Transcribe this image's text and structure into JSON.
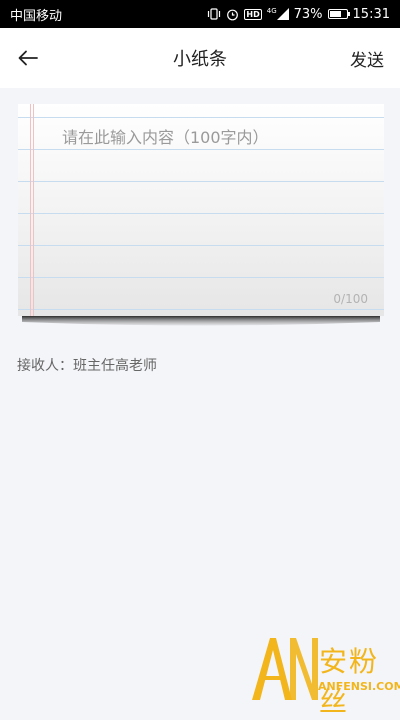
{
  "status_bar": {
    "carrier": "中国移动",
    "hd_badge": "HD",
    "network": "4G",
    "battery_percent": "73%",
    "battery_level": 0.73,
    "time": "15:31",
    "icons": [
      "vibrate-icon",
      "alarm-icon",
      "hd-icon",
      "signal-icon",
      "battery-icon"
    ]
  },
  "header": {
    "back_icon": "arrow-left-icon",
    "title": "小纸条",
    "send_label": "发送"
  },
  "note": {
    "placeholder": "请在此输入内容（100字内）",
    "value": "",
    "counter": "0/100"
  },
  "recipient": {
    "text": "接收人：班主任高老师"
  },
  "watermark": {
    "logo_text": "AN",
    "cn_text": "安粉丝",
    "en_text": "ANFENSI.COM"
  }
}
